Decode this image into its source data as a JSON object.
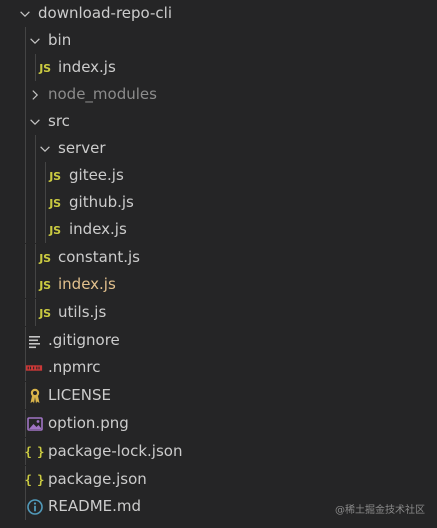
{
  "explorer": {
    "colors": {
      "background": "#252526",
      "text": "#cccccc",
      "ignored_text": "#8c8c8c",
      "modified_text": "#e2c08d",
      "js_icon": "#cbcb41",
      "json_icon": "#cbcb41",
      "npmrc_icon": "#cb3837",
      "license_icon": "#d9b44a",
      "info_icon": "#519aba",
      "image_icon": "#a074c4"
    },
    "tree": [
      {
        "name": "download-repo-cli",
        "kind": "folder",
        "expanded": true,
        "icon": "chevron-down-icon"
      },
      {
        "name": "bin",
        "kind": "folder",
        "expanded": true,
        "icon": "chevron-down-icon"
      },
      {
        "name": "index.js",
        "kind": "file",
        "icon": "js-icon",
        "icon_text": "JS"
      },
      {
        "name": "node_modules",
        "kind": "folder",
        "expanded": false,
        "icon": "chevron-right-icon"
      },
      {
        "name": "src",
        "kind": "folder",
        "expanded": true,
        "icon": "chevron-down-icon"
      },
      {
        "name": "server",
        "kind": "folder",
        "expanded": true,
        "icon": "chevron-down-icon"
      },
      {
        "name": "gitee.js",
        "kind": "file",
        "icon": "js-icon",
        "icon_text": "JS"
      },
      {
        "name": "github.js",
        "kind": "file",
        "icon": "js-icon",
        "icon_text": "JS"
      },
      {
        "name": "index.js",
        "kind": "file",
        "icon": "js-icon",
        "icon_text": "JS"
      },
      {
        "name": "constant.js",
        "kind": "file",
        "icon": "js-icon",
        "icon_text": "JS"
      },
      {
        "name": "index.js",
        "kind": "file",
        "icon": "js-icon",
        "icon_text": "JS"
      },
      {
        "name": "utils.js",
        "kind": "file",
        "icon": "js-icon",
        "icon_text": "JS"
      },
      {
        "name": ".gitignore",
        "kind": "file",
        "icon": "lines-icon"
      },
      {
        "name": ".npmrc",
        "kind": "file",
        "icon": "npm-icon"
      },
      {
        "name": "LICENSE",
        "kind": "file",
        "icon": "license-icon"
      },
      {
        "name": "option.png",
        "kind": "file",
        "icon": "image-icon"
      },
      {
        "name": "package-lock.json",
        "kind": "file",
        "icon": "json-icon",
        "icon_text": "{ }"
      },
      {
        "name": "package.json",
        "kind": "file",
        "icon": "json-icon",
        "icon_text": "{ }"
      },
      {
        "name": "README.md",
        "kind": "file",
        "icon": "info-icon"
      }
    ]
  },
  "watermark": "@稀土掘金技术社区"
}
